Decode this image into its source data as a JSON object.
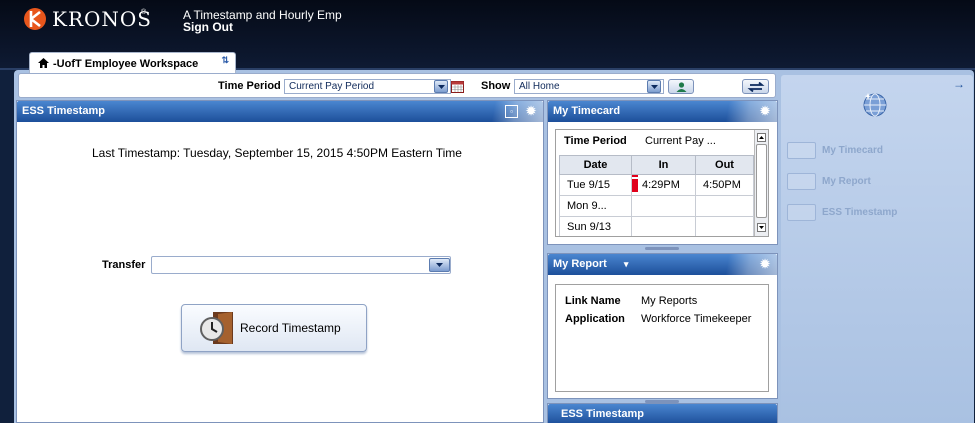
{
  "header": {
    "logo_text": "KRONOS",
    "logo_reg": "®",
    "user_name": "A Timestamp and Hourly Emp",
    "sign_out": "Sign Out"
  },
  "workspace_tab": {
    "label": "-UofT Employee Workspace"
  },
  "toolbar": {
    "time_period_label": "Time Period",
    "time_period_value": "Current Pay Period",
    "show_label": "Show",
    "show_value": "All Home"
  },
  "ess_panel": {
    "title": "ESS Timestamp",
    "last_timestamp": "Last Timestamp: Tuesday, September 15, 2015 4:50PM  Eastern Time",
    "transfer_label": "Transfer",
    "transfer_value": "",
    "record_button": "Record Timestamp"
  },
  "timecard_panel": {
    "title": "My Timecard",
    "time_period_label": "Time Period",
    "time_period_value": "Current Pay ...",
    "columns": [
      "Date",
      "In",
      "Out"
    ],
    "rows": [
      {
        "date": "Tue 9/15",
        "in": "4:29PM",
        "out": "4:50PM",
        "flag": true
      },
      {
        "date": "Mon 9...",
        "in": "",
        "out": "",
        "flag": false
      },
      {
        "date": "Sun 9/13",
        "in": "",
        "out": "",
        "flag": false
      }
    ]
  },
  "report_panel": {
    "title": "My Report",
    "link_name_label": "Link Name",
    "link_name_value": "My Reports",
    "application_label": "Application",
    "application_value": "Workforce Timekeeper"
  },
  "ess_panel_2": {
    "title": "ESS Timestamp"
  },
  "right_panel": {
    "items": [
      "My Timecard",
      "My Report",
      "ESS Timestamp"
    ]
  },
  "colors": {
    "header_blue": "#1d4f9a",
    "logo_orange": "#e8561c",
    "flag_red": "#e0001b"
  }
}
